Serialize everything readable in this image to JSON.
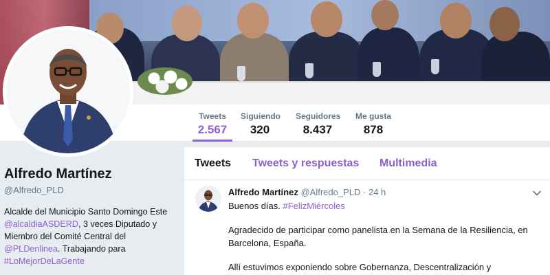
{
  "nav": {
    "tweets": {
      "label": "Tweets",
      "value": "2.567"
    },
    "following": {
      "label": "Siguiendo",
      "value": "320"
    },
    "followers": {
      "label": "Seguidores",
      "value": "8.437"
    },
    "likes": {
      "label": "Me gusta",
      "value": "878"
    }
  },
  "profile": {
    "name": "Alfredo Martínez",
    "handle": "@Alfredo_PLD",
    "bio": {
      "t1": "Alcalde del Municipio Santo Domingo Este",
      "link1": "@alcaldiaASDERD",
      "t2": ", 3 veces Diputado y Miembro del Comité Central del",
      "link2": "@PLDenlinea",
      "t3": ". Trabajando para",
      "link3": "#LoMejorDeLaGente"
    }
  },
  "tabs": {
    "tweets": "Tweets",
    "replies": "Tweets y respuestas",
    "media": "Multimedia"
  },
  "tweet": {
    "author": "Alfredo Martínez",
    "handle": "@Alfredo_PLD",
    "dot": "·",
    "time": "24 h",
    "line1": "Buenos días.",
    "hashtag": "#FelizMiércoles",
    "para2": "Agradecido de participar como panelista  en la Semana de la Resiliencia, en Barcelona, España.",
    "para3": "Allí estuvimos exponiendo sobre Gobernanza, Descentralización y Resiliencia."
  },
  "colors": {
    "accent": "#8c5fd0",
    "text": "#14171a",
    "muted": "#657786"
  },
  "icons": {
    "caret": "chevron-down-icon"
  }
}
